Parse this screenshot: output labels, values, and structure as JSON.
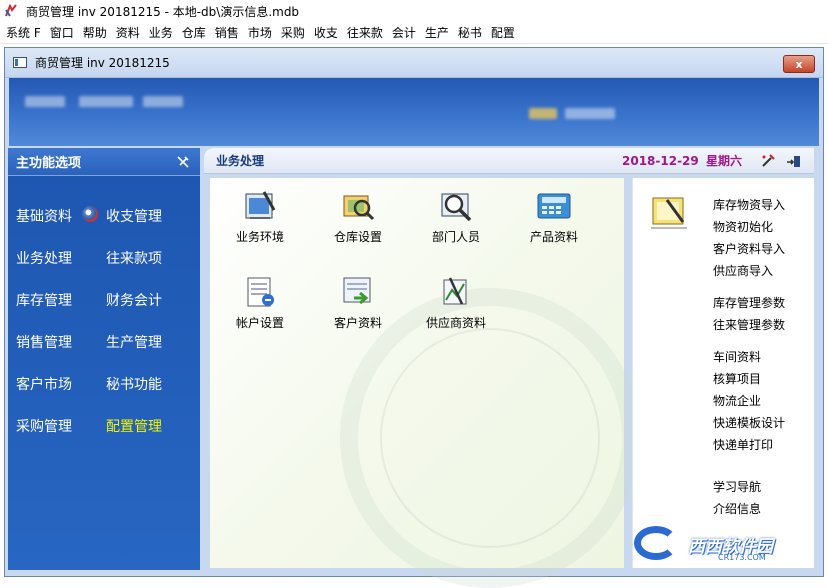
{
  "app": {
    "title": "商贸管理 inv 20181215 - 本地-db\\演示信息.mdb"
  },
  "menu": [
    "系统 F",
    "窗口",
    "帮助",
    "资料",
    "业务",
    "仓库",
    "销售",
    "市场",
    "采购",
    "收支",
    "往来款",
    "会计",
    "生产",
    "秘书",
    "配置"
  ],
  "window": {
    "title": "商贸管理 inv 20181215",
    "close_label": "x"
  },
  "left_panel": {
    "title": "主功能选项",
    "items": [
      {
        "label": "基础资料"
      },
      {
        "label": "收支管理"
      },
      {
        "label": "业务处理"
      },
      {
        "label": "往来款项"
      },
      {
        "label": "库存管理"
      },
      {
        "label": "财务会计"
      },
      {
        "label": "销售管理"
      },
      {
        "label": "生产管理"
      },
      {
        "label": "客户市场"
      },
      {
        "label": "秘书功能"
      },
      {
        "label": "采购管理"
      },
      {
        "label": "配置管理"
      }
    ],
    "active": "配置管理"
  },
  "center": {
    "title": "业务处理",
    "date": "2018-12-29",
    "weekday": "星期六",
    "tiles": [
      {
        "label": "业务环境",
        "icon": "business-env-icon"
      },
      {
        "label": "仓库设置",
        "icon": "warehouse-icon"
      },
      {
        "label": "部门人员",
        "icon": "department-icon"
      },
      {
        "label": "产品资料",
        "icon": "product-icon"
      },
      {
        "label": "帐户设置",
        "icon": "account-icon"
      },
      {
        "label": "客户资料",
        "icon": "customer-icon"
      },
      {
        "label": "供应商资料",
        "icon": "supplier-icon"
      }
    ]
  },
  "right_panel": {
    "links": [
      "库存物资导入",
      "物资初始化",
      "客户资料导入",
      "供应商导入",
      "库存管理参数",
      "往来管理参数",
      "车间资料",
      "核算项目",
      "物流企业",
      "快递模板设计",
      "快递单打印",
      "学习导航",
      "介绍信息"
    ]
  },
  "watermark": {
    "text": "西西软件园",
    "sub": "CR173.COM"
  },
  "colors": {
    "nav_bg": "#1d56b0",
    "active_nav": "#f3f400",
    "date": "#a0178b",
    "center_title": "#1a3c7c"
  }
}
